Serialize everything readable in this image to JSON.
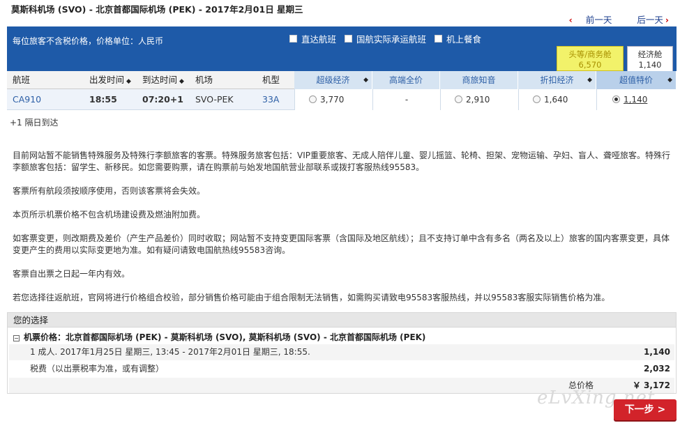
{
  "header": {
    "route_title": "莫斯科机场 (SVO) - 北京首都国际机场 (PEK) - 2017年2月01日 星期三",
    "prev_day": "前一天",
    "next_day": "后一天"
  },
  "bar": {
    "price_note": "每位旅客不含税价格，价格单位：人民币",
    "filters": [
      "直达航班",
      "国航实际承运航班",
      "机上餐食"
    ],
    "cabins": [
      {
        "label": "头等/商务舱",
        "price": "6,570"
      },
      {
        "label": "经济舱",
        "price": "1,140"
      }
    ]
  },
  "table": {
    "columns": [
      "航班",
      "出发时间",
      "到达时间",
      "机场",
      "机型"
    ],
    "fare_columns": [
      "超级经济",
      "高端全价",
      "商旅知音",
      "折扣经济",
      "超值特价"
    ],
    "row": {
      "flight": "CA910",
      "depart": "18:55",
      "arrive": "07:20+1",
      "airport": "SVO-PEK",
      "aircraft": "33A",
      "fares": [
        "3,770",
        "-",
        "2,910",
        "1,640",
        "1,140"
      ]
    },
    "next_day_note": "+1 隔日到达"
  },
  "notices": [
    "目前网站暂不能销售特殊服务及特殊行李额旅客的客票。特殊服务旅客包括：VIP重要旅客、无成人陪伴儿童、婴儿摇篮、轮椅、担架、宠物运输、孕妇、盲人、聋哑旅客。特殊行李额旅客包括：留学生、新移民。如您需要购票，请在购票前与始发地国航营业部联系或拨打客服热线95583。",
    "客票所有航段须按顺序使用，否则该客票将会失效。",
    "本页所示机票价格不包含机场建设费及燃油附加费。",
    "如客票变更，则改期费及差价（产生产品差价）同时收取；网站暂不支持变更国际客票（含国际及地区航线）；且不支持订单中含有多名（两名及以上）旅客的国内客票变更，具体变更产生的费用以实际变更地为准。如有疑问请致电国航热线95583咨询。",
    "客票自出票之日起一年内有效。",
    "若您选择往返航班，官网将进行价格组合校验，部分销售价格可能由于组合限制无法销售，如需购买请致电95583客服热线，并以95583客服实际销售价格为准。"
  ],
  "selection": {
    "heading": "您的选择",
    "route": "机票价格：北京首都国际机场 (PEK) - 莫斯科机场 (SVO), 莫斯科机场 (SVO) - 北京首都国际机场 (PEK)",
    "passenger_line": "1 成人. 2017年1月25日 星期三, 13:45 - 2017年2月01日 星期三, 18:55.",
    "passenger_amount": "1,140",
    "tax_line": "税费（以出票税率为准，或有调整）",
    "tax_amount": "2,032",
    "total_label": "总价格",
    "total_amount": "￥ 3,172"
  },
  "watermark": "eLvXing.net",
  "next_button": "下一步 >"
}
